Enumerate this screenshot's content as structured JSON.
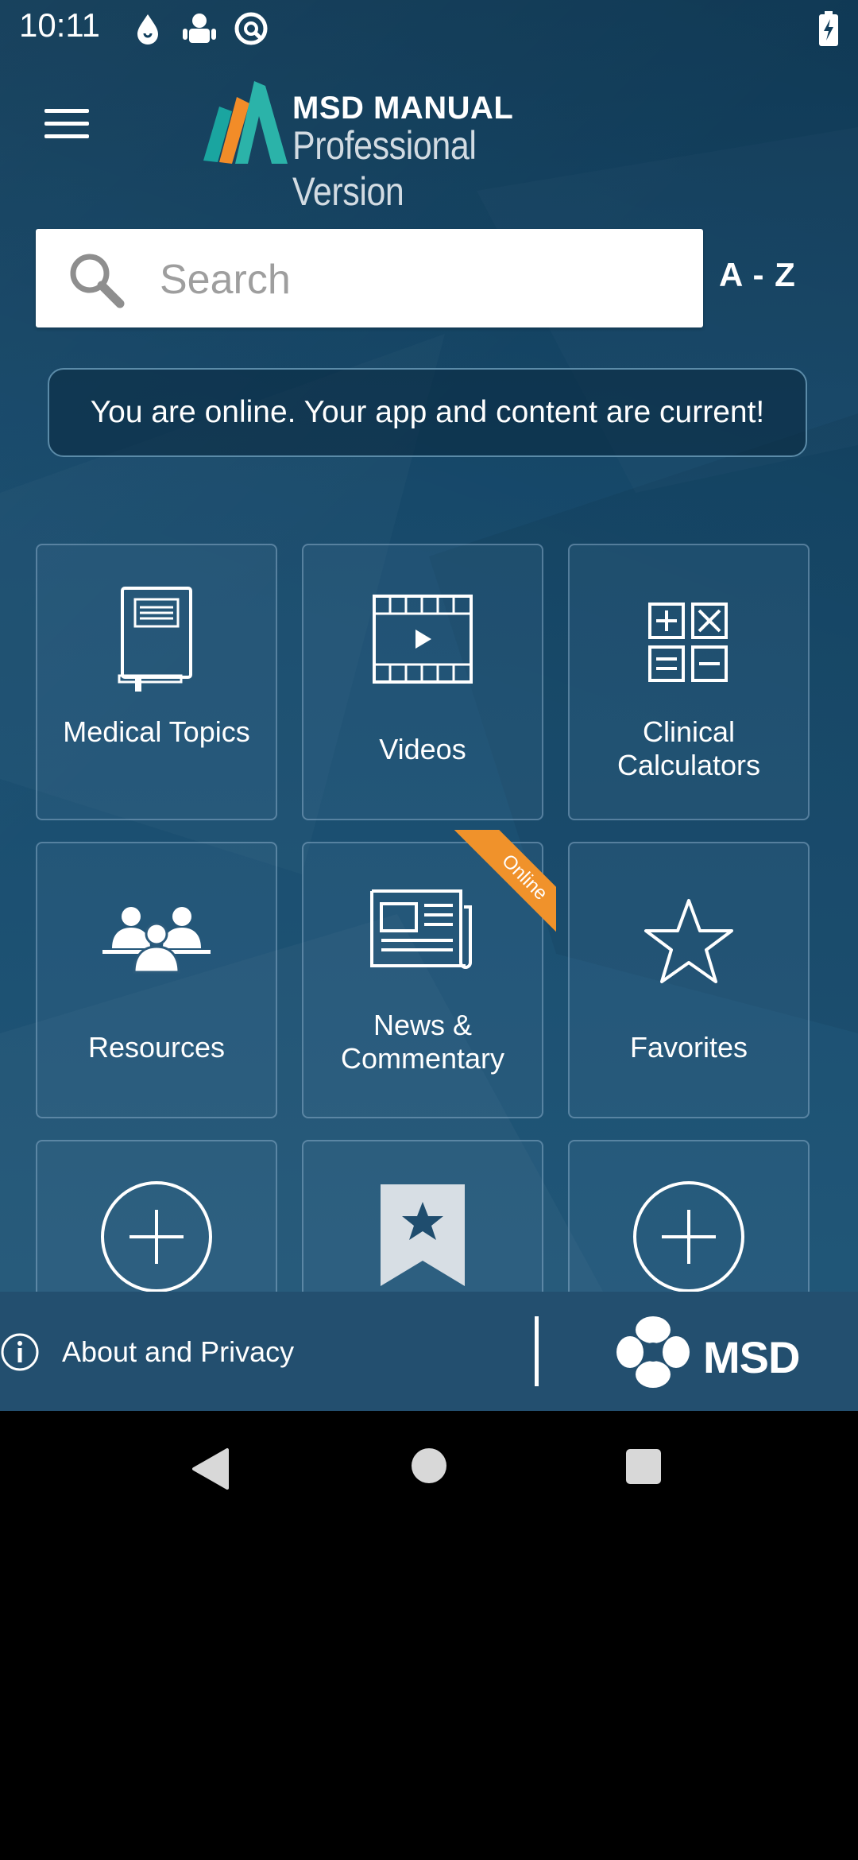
{
  "status_bar": {
    "time": "10:11"
  },
  "header": {
    "logo_line1": "MSD MANUAL",
    "logo_line2": "Professional Version"
  },
  "search": {
    "placeholder": "Search",
    "az_label": "A - Z"
  },
  "banner": {
    "text": "You are online. Your app and content are current!"
  },
  "tiles": [
    {
      "label": "Medical Topics",
      "icon": "book-icon"
    },
    {
      "label": "Videos",
      "icon": "film-icon"
    },
    {
      "label": "Clinical Calculators",
      "icon": "calculator-icon"
    },
    {
      "label": "Resources",
      "icon": "people-icon"
    },
    {
      "label": "News & Commentary",
      "icon": "newspaper-icon",
      "badge": "Online"
    },
    {
      "label": "Favorites",
      "icon": "star-icon"
    },
    {
      "label": "",
      "icon": "plus-circle-icon"
    },
    {
      "label": "",
      "icon": "bookmark-star-icon"
    },
    {
      "label": "",
      "icon": "plus-circle-icon"
    }
  ],
  "footer": {
    "about_label": "About and Privacy",
    "brand": "MSD"
  },
  "colors": {
    "background": "#174a6c",
    "footer": "#234f6f",
    "ribbon": "#f0922b"
  }
}
